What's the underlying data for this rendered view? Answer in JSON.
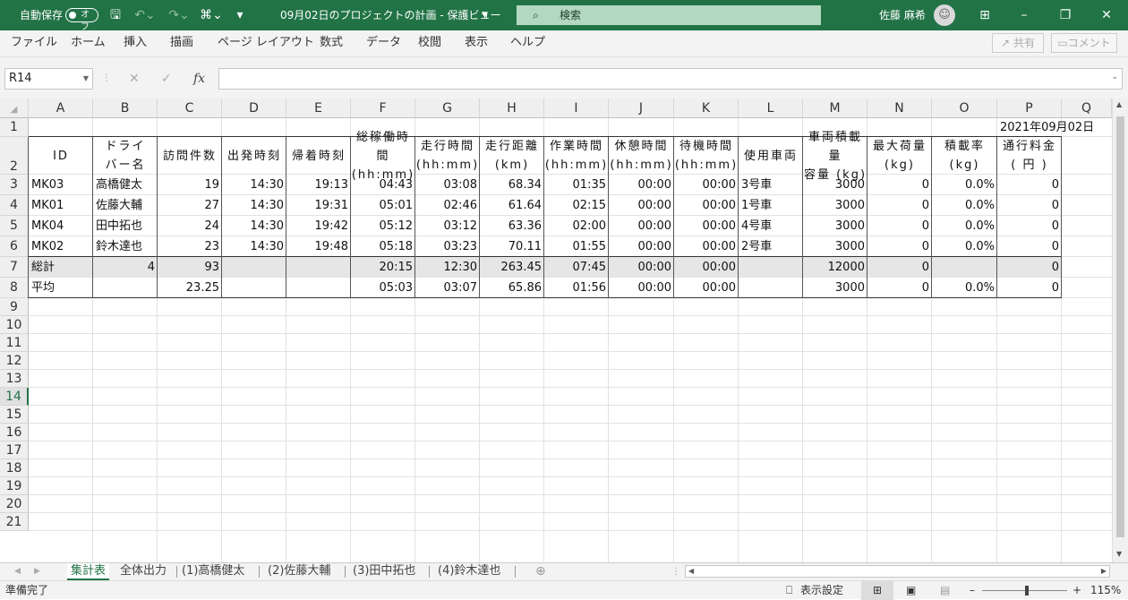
{
  "titlebar": {
    "autosave_label": "自動保存",
    "autosave_state": "オフ",
    "document_title": "09月02日のプロジェクトの計画 - 保護ビュー",
    "search_placeholder": "検索",
    "user_name": "佐藤 麻希"
  },
  "ribbon": {
    "tabs": [
      "ファイル",
      "ホーム",
      "挿入",
      "描画",
      "ページ レイアウト",
      "数式",
      "データ",
      "校閲",
      "表示",
      "ヘルプ"
    ],
    "share_label": "共有",
    "comment_label": "コメント"
  },
  "formula_bar": {
    "name_box": "R14",
    "fx": "fx",
    "formula": ""
  },
  "columns": [
    "A",
    "B",
    "C",
    "D",
    "E",
    "F",
    "G",
    "H",
    "I",
    "J",
    "K",
    "L",
    "M",
    "N",
    "O",
    "P",
    "Q"
  ],
  "rows": [
    "1",
    "2",
    "3",
    "4",
    "5",
    "6",
    "7",
    "8",
    "9",
    "10",
    "11",
    "12",
    "13",
    "14",
    "15",
    "16",
    "17",
    "18",
    "19",
    "20",
    "21"
  ],
  "selected_row": "14",
  "sheet": {
    "date": "2021年09月02日",
    "headers": {
      "id": "ID",
      "driver": [
        "ドライ",
        "バー名"
      ],
      "visits": "訪問件数",
      "depart": "出発時刻",
      "return": "帰着時刻",
      "total_work": [
        "総稼働時",
        "間",
        "(hh:mm)"
      ],
      "drive_time": [
        "走行時間",
        "(hh:mm)"
      ],
      "distance": [
        "走行距離",
        "(km)"
      ],
      "work_time": [
        "作業時間",
        "(hh:mm)"
      ],
      "rest_time": [
        "休憩時間",
        "(hh:mm)"
      ],
      "wait_time": [
        "待機時間",
        "(hh:mm)"
      ],
      "vehicle": "使用車両",
      "capacity": [
        "車両積載",
        "量",
        "容量 (kg)"
      ],
      "max_load": [
        "最大荷量",
        "(kg)"
      ],
      "load_rate": [
        "積載率",
        "(kg)"
      ],
      "toll": [
        "通行料金",
        "( 円 )"
      ]
    },
    "data_rows": [
      [
        "MK03",
        "高橋健太",
        "19",
        "14:30",
        "19:13",
        "04:43",
        "03:08",
        "68.34",
        "01:35",
        "00:00",
        "00:00",
        "3号車",
        "3000",
        "0",
        "0.0%",
        "0"
      ],
      [
        "MK01",
        "佐藤大輔",
        "27",
        "14:30",
        "19:31",
        "05:01",
        "02:46",
        "61.64",
        "02:15",
        "00:00",
        "00:00",
        "1号車",
        "3000",
        "0",
        "0.0%",
        "0"
      ],
      [
        "MK04",
        "田中拓也",
        "24",
        "14:30",
        "19:42",
        "05:12",
        "03:12",
        "63.36",
        "02:00",
        "00:00",
        "00:00",
        "4号車",
        "3000",
        "0",
        "0.0%",
        "0"
      ],
      [
        "MK02",
        "鈴木達也",
        "23",
        "14:30",
        "19:48",
        "05:18",
        "03:23",
        "70.11",
        "01:55",
        "00:00",
        "00:00",
        "2号車",
        "3000",
        "0",
        "0.0%",
        "0"
      ]
    ],
    "total_row": [
      "総計",
      "4",
      "93",
      "",
      "",
      "20:15",
      "12:30",
      "263.45",
      "07:45",
      "00:00",
      "00:00",
      "",
      "12000",
      "0",
      "",
      "0"
    ],
    "avg_row": [
      "平均",
      "",
      "23.25",
      "",
      "",
      "05:03",
      "03:07",
      "65.86",
      "01:56",
      "00:00",
      "00:00",
      "",
      "3000",
      "0",
      "0.0%",
      "0"
    ]
  },
  "sheet_tabs": [
    "集計表",
    "全体出力",
    "(1)高橋健太",
    "(2)佐藤大輔",
    "(3)田中拓也",
    "(4)鈴木達也"
  ],
  "active_tab": "集計表",
  "status": {
    "ready": "準備完了",
    "display_settings": "表示設定",
    "zoom": "115%"
  }
}
